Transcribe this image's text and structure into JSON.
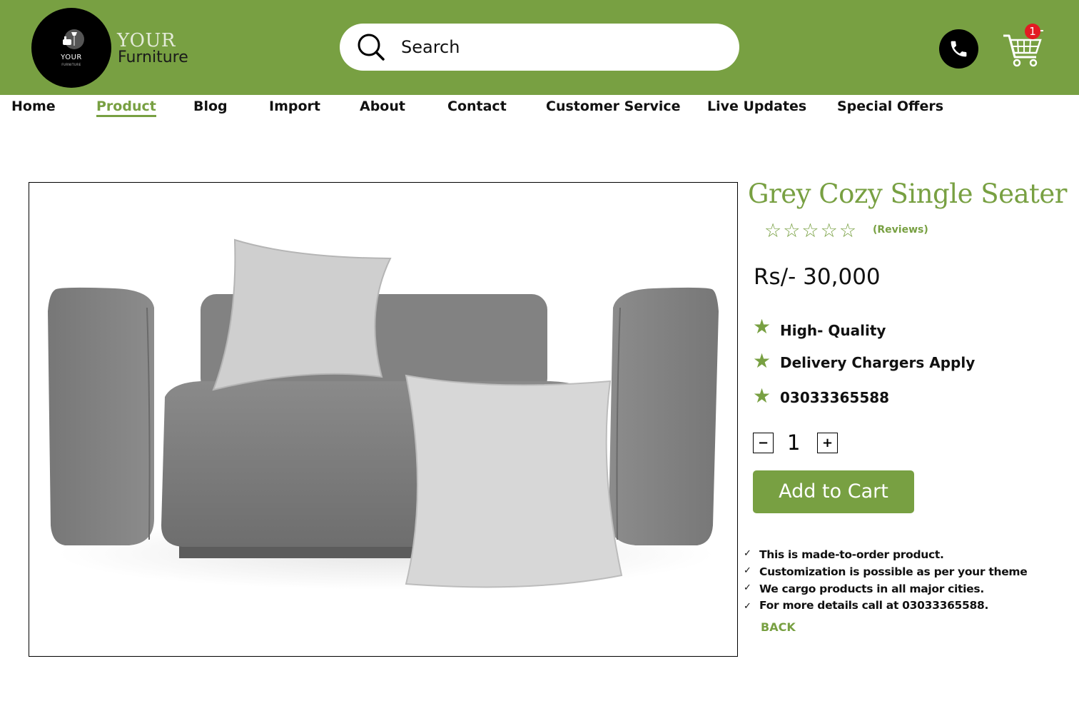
{
  "header": {
    "logo_text_small": "YOUR",
    "logo_text_tiny": "FURNITURE",
    "brand_line1": "YOUR",
    "brand_line2": "Furniture",
    "search_placeholder": "Search",
    "phone_icon": "phone-icon",
    "cart_icon": "cart-icon",
    "cart_count": "1",
    "accent_color": "#78a042",
    "badge_color": "#e31b23"
  },
  "nav": {
    "items": [
      {
        "label": "Home"
      },
      {
        "label": "Product"
      },
      {
        "label": "Blog"
      },
      {
        "label": "Import"
      },
      {
        "label": "About"
      },
      {
        "label": "Contact"
      },
      {
        "label": "Customer Service"
      },
      {
        "label": "Live Updates"
      },
      {
        "label": "Special Offers"
      }
    ],
    "active": "Product"
  },
  "product": {
    "title": "Grey Cozy Single Seater",
    "rating_stars": "☆☆☆☆☆",
    "rating": 0,
    "rating_max": 5,
    "reviews_label": "(Reviews)",
    "price": "Rs/- 30,000",
    "features": [
      {
        "icon": "★",
        "text": "High- Quality"
      },
      {
        "icon": "★",
        "text": "Delivery Chargers Apply"
      },
      {
        "icon": "★",
        "text": "03033365588"
      }
    ],
    "quantity": "1",
    "qty_minus": "−",
    "qty_plus": "+",
    "add_to_cart_label": "Add to Cart",
    "notes": [
      {
        "icon": "✓",
        "text": "This is made-to-order product."
      },
      {
        "icon": "✓",
        "text": "Customization is possible as per your theme"
      },
      {
        "icon": "✓",
        "text": "We cargo products in all major cities."
      },
      {
        "icon": "✓",
        "text": "For more details call at 03033365588."
      }
    ],
    "back_label": "BACK"
  }
}
